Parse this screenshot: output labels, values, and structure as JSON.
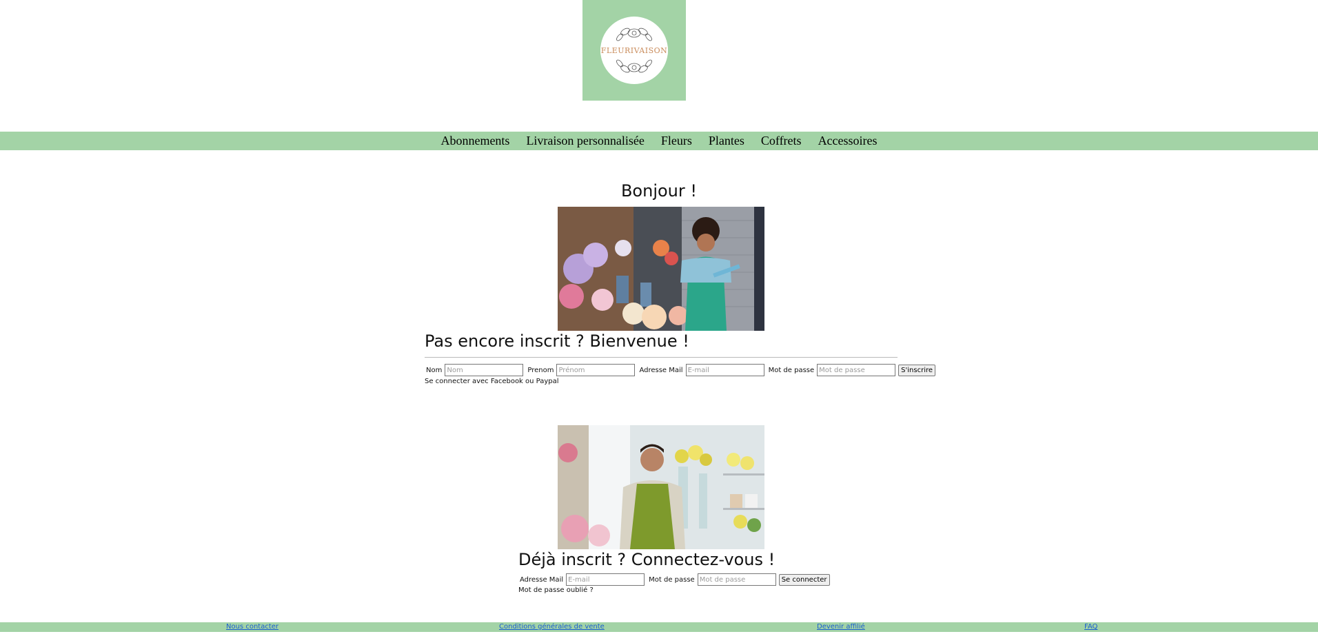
{
  "brand": {
    "logo_text": "FLEURIVAISON",
    "accent_color": "#a3d3a6"
  },
  "nav": {
    "items": [
      {
        "label": "Abonnements"
      },
      {
        "label": "Livraison personnalisée"
      },
      {
        "label": "Fleurs"
      },
      {
        "label": "Plantes"
      },
      {
        "label": "Coffrets"
      },
      {
        "label": "Accessoires"
      }
    ]
  },
  "main": {
    "greeting": "Bonjour !",
    "signup": {
      "title": "Pas encore inscrit ? Bienvenue !",
      "fields": [
        {
          "label": "Nom",
          "placeholder": "Nom",
          "value": ""
        },
        {
          "label": "Prenom",
          "placeholder": "Prénom",
          "value": ""
        },
        {
          "label": "Adresse Mail",
          "placeholder": "E-mail",
          "value": ""
        },
        {
          "label": "Mot de passe",
          "placeholder": "Mot de passe",
          "value": ""
        }
      ],
      "submit_label": "S'inscrire",
      "social_note": "Se connecter avec Facebook ou Paypal"
    },
    "login": {
      "title": "Déjà inscrit ? Connectez-vous !",
      "fields": [
        {
          "label": "Adresse Mail",
          "placeholder": "E-mail",
          "value": ""
        },
        {
          "label": "Mot de passe",
          "placeholder": "Mot de passe",
          "value": ""
        }
      ],
      "submit_label": "Se connecter",
      "forgot_note": "Mot de passe oublié ?"
    }
  },
  "footer": {
    "links": [
      {
        "label": "Nous contacter"
      },
      {
        "label": "Conditions générales de vente"
      },
      {
        "label": "Devenir affilié"
      },
      {
        "label": "FAQ"
      }
    ]
  }
}
